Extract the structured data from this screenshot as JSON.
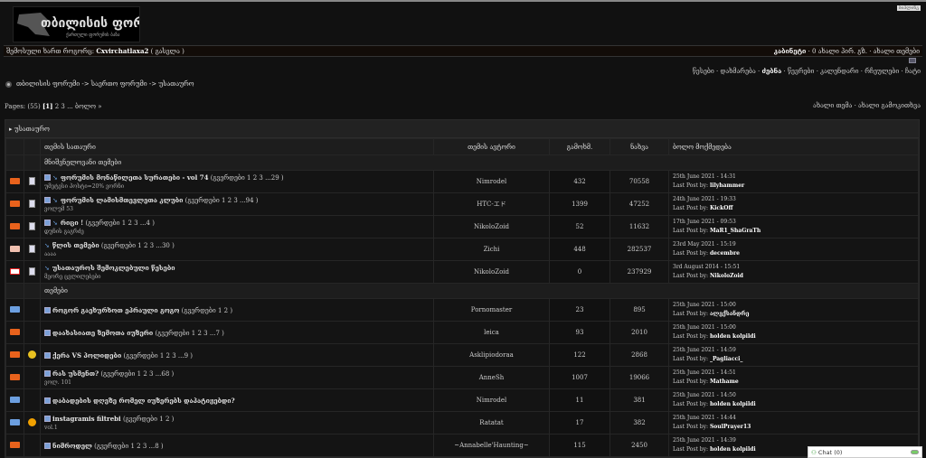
{
  "logo": {
    "title": "თბილისის ფორუმი",
    "subtitle": "ქართული ფორუმის ბაზა"
  },
  "top_badge": "ბიპლინკ",
  "userbar": {
    "logged_as": "შემოსული ხართ როგორც:",
    "username": "Cxvirchatlaxa2",
    "logout": "( გასვლა )",
    "cabinet": "კაბინეტი",
    "pm": "· 0 ახალი პირ. გზ. · ახალი თემები"
  },
  "nav": {
    "items": [
      "წესები",
      "დახმარება",
      "ძებნა",
      "წევრები",
      "კალენდარი",
      "რჩეულები",
      "ჩატი"
    ],
    "active": 2
  },
  "breadcrumb": "თბილისის ფორუმი -> საერთო ფორუმი -> უსათაურო",
  "pagination": {
    "prefix": "Pages: (55)",
    "current": "[1]",
    "rest": "2 3 ... ბოლო »"
  },
  "new_links": "ახალი თემა · ახალი გამოკითხვა",
  "category": "▸ უსათაურო",
  "columns": {
    "title": "თემის სათაური",
    "author": "თემის ავტორი",
    "replies": "გამოხმ.",
    "views": "ნახვა",
    "last": "ბოლო მოქმედება"
  },
  "sections": {
    "pinned": "მნიშვნელოვანი თემები",
    "topics": "თემები"
  },
  "pinned": [
    {
      "status": "o",
      "title": "ფორუმის მონაწილეთა სურათები - vol 74",
      "pages": "(გვერდები 1 2 3 ...29 )",
      "desc": "უმეტესი პოსტი=20% ვორნი",
      "author": "Nimrodel",
      "replies": "432",
      "views": "70558",
      "date": "25th June 2021 - 14:31",
      "by": "lilyhammer",
      "mini": true
    },
    {
      "status": "o",
      "title": "ფორუმის ლამისმთევლეთა კლუბი",
      "pages": "(გვერდები 1 2 3 ...94 )",
      "desc": "ვოლუმ 53",
      "author": "HTC-エド",
      "replies": "1399",
      "views": "47252",
      "date": "24th June 2021 - 19:33",
      "by": "KickOff",
      "mini": true
    },
    {
      "status": "o",
      "title": "რიცი !",
      "pages": "(გვერდები 1 2 3 ...4 )",
      "desc": "დუნის გაგრძე",
      "author": "NikoloZoid",
      "replies": "52",
      "views": "11632",
      "date": "17th June 2021 - 09:53",
      "by": "MaR1_ShaGraTh",
      "mini": true
    },
    {
      "status": "p",
      "title": "წლის თემები",
      "pages": "(გვერდები 1 2 3 ...30 )",
      "desc": "აააა",
      "author": "Zichi",
      "replies": "448",
      "views": "282537",
      "date": "23rd May 2021 - 15:19",
      "by": "decembre",
      "mini": false
    },
    {
      "status": "r",
      "title": "უსათაუროს შემოკლებული წესები",
      "pages": "",
      "desc": "მეორე ცვლილებები",
      "author": "NikoloZoid",
      "replies": "0",
      "views": "237929",
      "date": "3rd August 2014 - 15:51",
      "by": "NikoloZoid",
      "mini": false
    }
  ],
  "topics": [
    {
      "status": "b",
      "icon": "",
      "title": "როგორ გაეხურხოთ ეპრაული გოგო",
      "pages": "(გვერდები 1 2 )",
      "desc": "",
      "author": "Pornomaster",
      "replies": "23",
      "views": "895",
      "date": "25th June 2021 - 15:00",
      "by": "ალექსანდრე"
    },
    {
      "status": "o",
      "icon": "",
      "title": "დაახასიათე ზემოთა იუზერი",
      "pages": "(გვერდები 1 2 3 ...7 )",
      "desc": "",
      "author": "leica",
      "replies": "93",
      "views": "2010",
      "date": "25th June 2021 - 15:00",
      "by": "holden kolpildi"
    },
    {
      "status": "o",
      "icon": "cool",
      "title": "ქერა VS პოლიდები",
      "pages": "(გვერდები 1 2 3 ...9 )",
      "desc": "",
      "author": "Asklipiodoraa",
      "replies": "122",
      "views": "2868",
      "date": "25th June 2021 - 14:59",
      "by": "_Pagliacci_"
    },
    {
      "status": "o",
      "icon": "",
      "title": "რას უსმენთ?",
      "pages": "(გვერდები 1 2 3 ...68 )",
      "desc": "ვოლ. 101",
      "author": "AnneSh",
      "replies": "1007",
      "views": "19066",
      "date": "25th June 2021 - 14:51",
      "by": "Mathame"
    },
    {
      "status": "b",
      "icon": "",
      "title": "დაბადების დღეზე რომელ იუზერებს დაპატიჟებდი?",
      "pages": "",
      "desc": "",
      "author": "Nimrodel",
      "replies": "11",
      "views": "381",
      "date": "25th June 2021 - 14:50",
      "by": "holden kolpildi"
    },
    {
      "status": "b",
      "icon": "warn",
      "title": "instagramis filtrebi",
      "pages": "(გვერდები 1 2 )",
      "desc": "vol.1",
      "author": "Ratatat",
      "replies": "17",
      "views": "382",
      "date": "25th June 2021 - 14:44",
      "by": "SoulPrayer13"
    },
    {
      "status": "o",
      "icon": "",
      "title": "ნიმროდელ",
      "pages": "(გვერდები 1 2 3 ...8 )",
      "desc": "",
      "author": "~Annabelle'Haunting~",
      "replies": "115",
      "views": "2450",
      "date": "25th June 2021 - 14:39",
      "by": "holden kolpildi"
    }
  ],
  "last_post_label": "Last Post by:",
  "chat": {
    "label": "Chat",
    "count": "(0)"
  }
}
